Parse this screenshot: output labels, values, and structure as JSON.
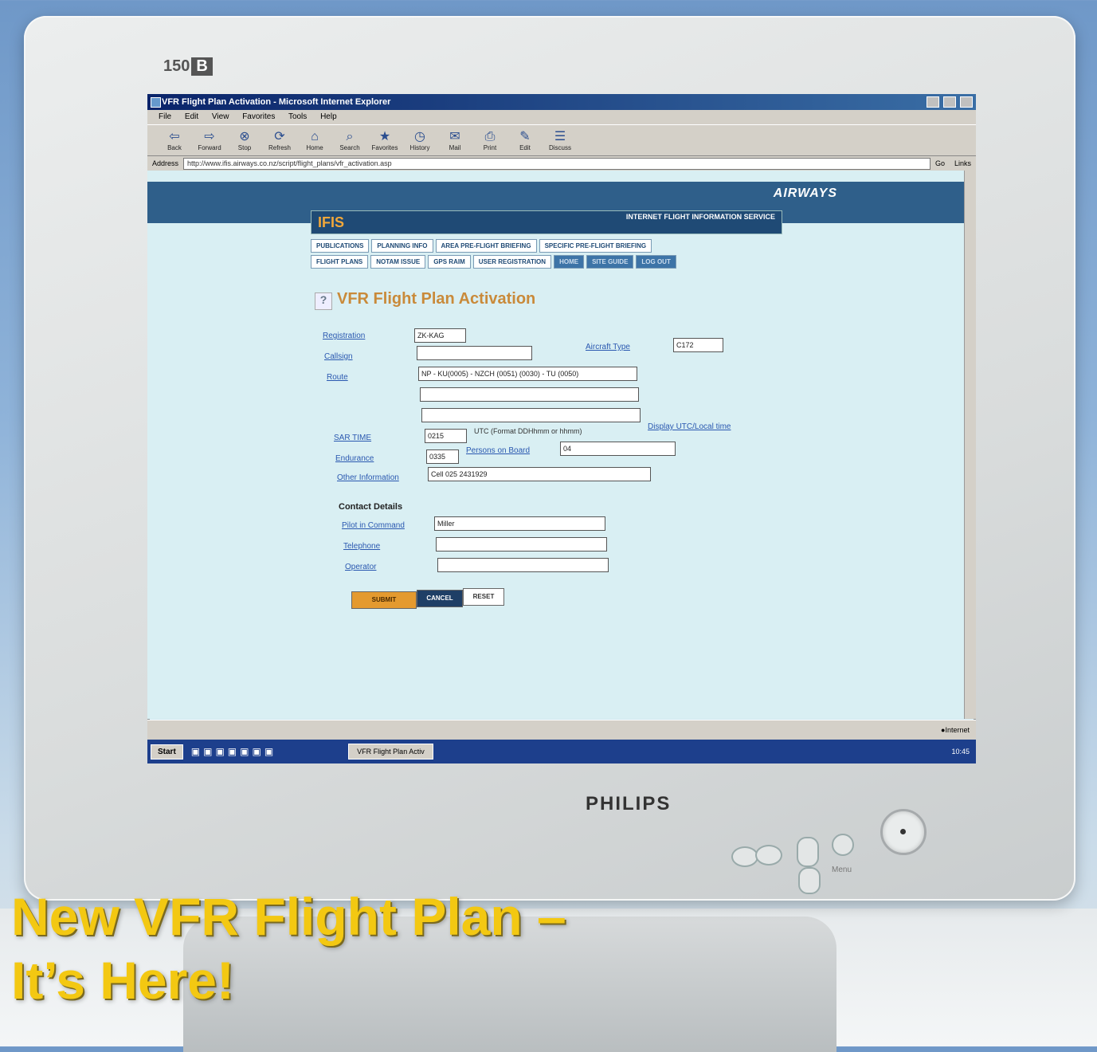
{
  "monitor": {
    "model": "150",
    "model_badge": "B",
    "brand": "PHILIPS",
    "menu_button_label": "Menu"
  },
  "browser": {
    "title": "VFR Flight Plan Activation - Microsoft Internet Explorer",
    "menu": [
      "File",
      "Edit",
      "View",
      "Favorites",
      "Tools",
      "Help"
    ],
    "toolbar": [
      {
        "label": "Back",
        "icon": "back-arrow-icon",
        "glyph": "⇦"
      },
      {
        "label": "Forward",
        "icon": "forward-arrow-icon",
        "glyph": "⇨"
      },
      {
        "label": "Stop",
        "icon": "stop-icon",
        "glyph": "⊗"
      },
      {
        "label": "Refresh",
        "icon": "refresh-icon",
        "glyph": "⟳"
      },
      {
        "label": "Home",
        "icon": "home-icon",
        "glyph": "⌂"
      },
      {
        "label": "Search",
        "icon": "search-icon",
        "glyph": "⌕"
      },
      {
        "label": "Favorites",
        "icon": "favorites-icon",
        "glyph": "★"
      },
      {
        "label": "History",
        "icon": "history-icon",
        "glyph": "◷"
      },
      {
        "label": "Mail",
        "icon": "mail-icon",
        "glyph": "✉"
      },
      {
        "label": "Print",
        "icon": "print-icon",
        "glyph": "⎙"
      },
      {
        "label": "Edit",
        "icon": "edit-icon",
        "glyph": "✎"
      },
      {
        "label": "Discuss",
        "icon": "discuss-icon",
        "glyph": "☰"
      }
    ],
    "address_label": "Address",
    "address_url": "http://www.ifis.airways.co.nz/script/flight_plans/vfr_activation.asp",
    "go_label": "Go",
    "links_label": "Links",
    "status_text": "Internet",
    "clock": "10:45"
  },
  "site": {
    "brand": "AIRWAYS",
    "logo": "IFIS",
    "subtitle": "INTERNET FLIGHT INFORMATION SERVICE",
    "nav_row1": [
      "PUBLICATIONS",
      "PLANNING INFO",
      "AREA PRE-FLIGHT BRIEFING",
      "SPECIFIC PRE-FLIGHT BRIEFING"
    ],
    "nav_row2": [
      "FLIGHT PLANS",
      "NOTAM ISSUE",
      "GPS RAIM",
      "USER REGISTRATION"
    ],
    "nav_row2_dark": [
      "HOME",
      "SITE GUIDE",
      "LOG OUT"
    ]
  },
  "form": {
    "page_title": "VFR Flight Plan Activation",
    "help_icon": "?",
    "registration": {
      "label": "Registration",
      "value": "ZK-KAG"
    },
    "aircraft_type": {
      "label": "Aircraft Type",
      "value": "C172"
    },
    "callsign": {
      "label": "Callsign",
      "value": ""
    },
    "route": {
      "label": "Route",
      "value": "NP - KU(0005) - NZCH (0051) (0030) - TU (0050)",
      "line2": "",
      "line3": ""
    },
    "sar_time": {
      "label": "SAR TIME",
      "value": "0215",
      "hint": "UTC (Format DDHhmm or hhmm)",
      "link": "Display UTC/Local time"
    },
    "endurance": {
      "label": "Endurance",
      "value": "0335"
    },
    "persons": {
      "label": "Persons on Board",
      "value": "04"
    },
    "other": {
      "label": "Other Information",
      "value": "Cell 025 2431929"
    },
    "contact_heading": "Contact Details",
    "pilot": {
      "label": "Pilot in Command",
      "value": "Miller"
    },
    "telephone": {
      "label": "Telephone",
      "value": ""
    },
    "operator": {
      "label": "Operator",
      "value": ""
    },
    "buttons": {
      "submit": "SUBMIT",
      "cancel": "CANCEL",
      "reset": "RESET"
    }
  },
  "taskbar": {
    "start": "Start",
    "task": "VFR Flight Plan Activ"
  },
  "headline": {
    "line1": "New VFR Flight Plan –",
    "line2": "It’s Here!"
  },
  "colors": {
    "headline": "#f3c812",
    "ifis_bar": "#1f4a75",
    "submit": "#e49a2f"
  }
}
